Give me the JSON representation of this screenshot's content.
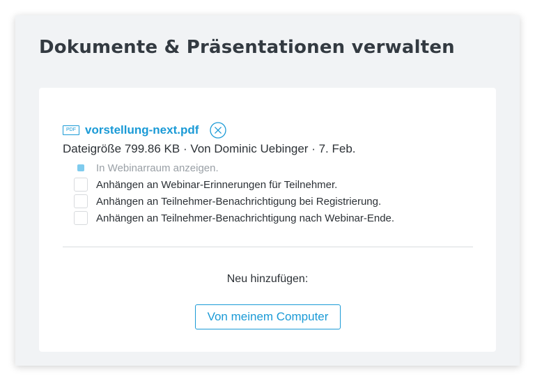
{
  "panel": {
    "title": "Dokumente & Präsentationen verwalten"
  },
  "document": {
    "type_badge": "PDF",
    "icon": "pdf-file-icon",
    "filename": "vorstellung-next.pdf",
    "remove_icon": "close-circle-icon",
    "meta": "Dateigröße 799.86 KB · Von Dominic Uebinger · 7. Feb."
  },
  "options": [
    {
      "label": "In Webinarraum anzeigen.",
      "checked": true,
      "disabled": true
    },
    {
      "label": "Anhängen an Webinar-Erinnerungen für Teilnehmer.",
      "checked": false,
      "disabled": false
    },
    {
      "label": "Anhängen an Teilnehmer-Benachrichtigung bei Registrierung.",
      "checked": false,
      "disabled": false
    },
    {
      "label": "Anhängen an Teilnehmer-Benachrichtigung nach Webinar-Ende.",
      "checked": false,
      "disabled": false
    }
  ],
  "add_new": {
    "label": "Neu hinzufügen:",
    "button_label": "Von meinem Computer"
  },
  "colors": {
    "accent": "#1a9ad6",
    "panel_background": "#f1f3f5",
    "card_background": "#ffffff",
    "text": "#2c3136",
    "checked_disabled": "#7fcbee"
  }
}
